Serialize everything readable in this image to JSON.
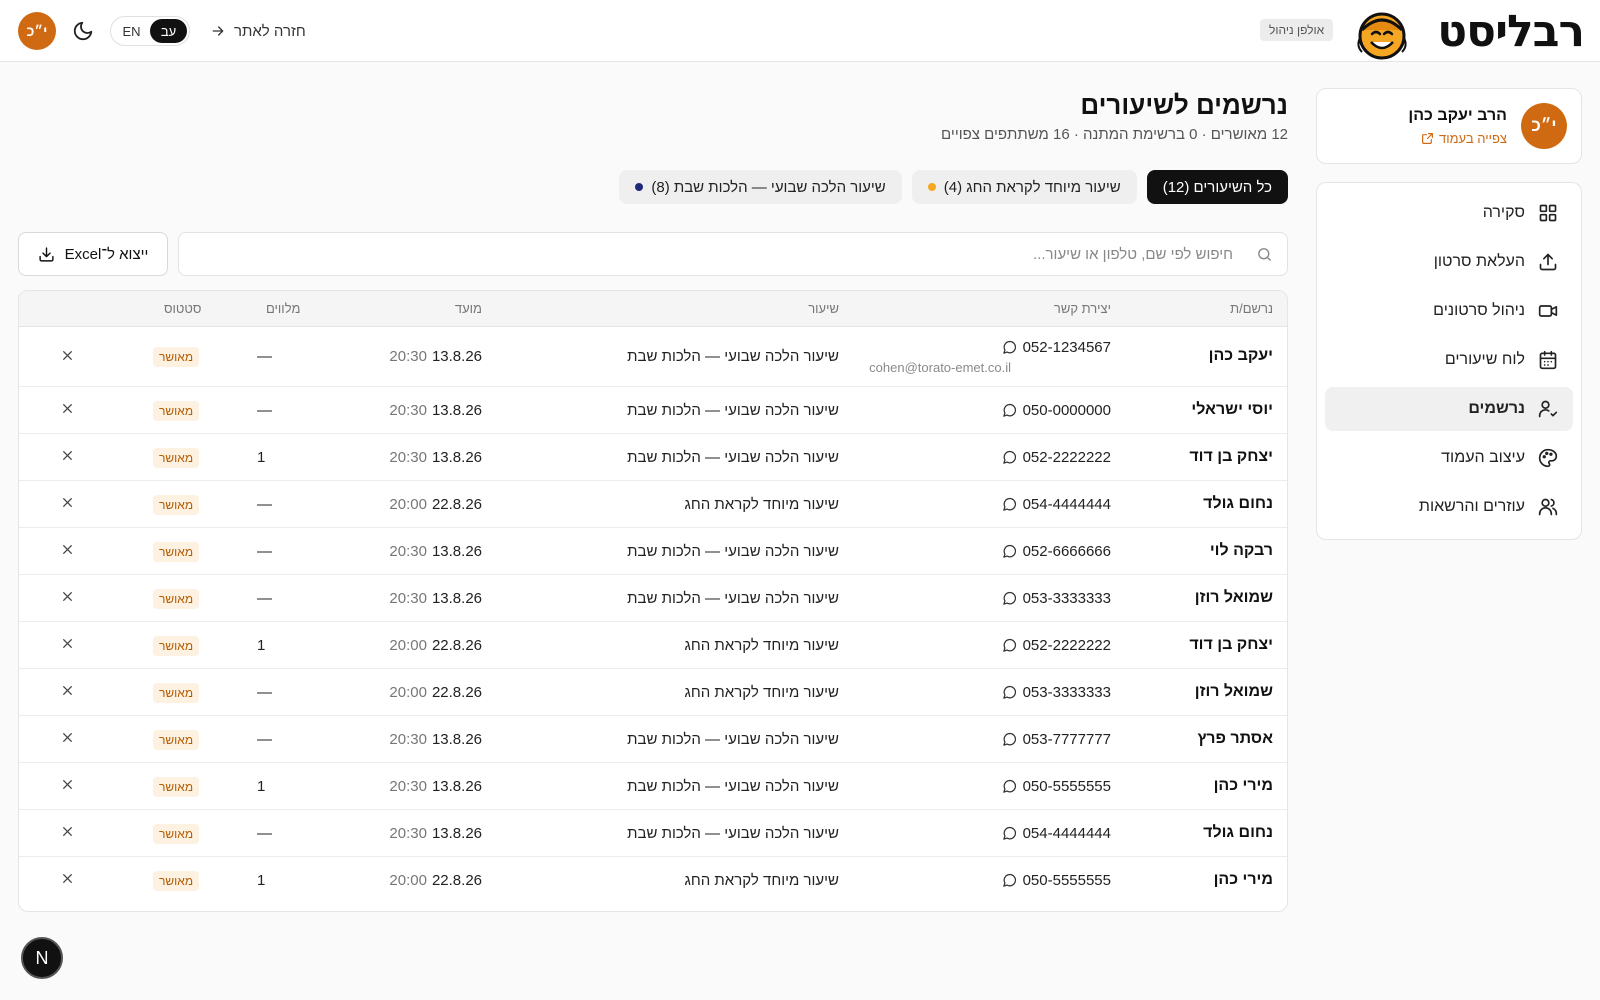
{
  "header": {
    "avatar_initials": "י״כ",
    "lang_en": "EN",
    "lang_he": "עב",
    "back_label": "חזרה לאתר",
    "studio_badge": "אולפן ניהול",
    "logo_text": "רבליסט",
    "accent_color": "#cf6a12"
  },
  "profile": {
    "initials": "י״כ",
    "name": "הרב יעקב כהן",
    "view_page_label": "צפייה בעמוד"
  },
  "nav": {
    "items": [
      {
        "label": "סקירה",
        "icon": "dashboard-icon"
      },
      {
        "label": "העלאת סרטון",
        "icon": "upload-icon"
      },
      {
        "label": "ניהול סרטונים",
        "icon": "video-icon"
      },
      {
        "label": "לוח שיעורים",
        "icon": "calendar-icon"
      },
      {
        "label": "נרשמים",
        "icon": "user-check-icon",
        "active": true
      },
      {
        "label": "עיצוב העמוד",
        "icon": "palette-icon"
      },
      {
        "label": "עוזרים והרשאות",
        "icon": "users-icon"
      }
    ]
  },
  "main": {
    "title": "נרשמים לשיעורים",
    "subtitle": "12 מאושרים · 0 ברשימת המתנה · 16 משתתפים צפויים",
    "filters": [
      {
        "label": "כל השיעורים (12)",
        "active": true,
        "dot_color": ""
      },
      {
        "label": "שיעור מיוחד לקראת החג (4)",
        "active": false,
        "dot_color": "#f5a623"
      },
      {
        "label": "שיעור הלכה שבועי — הלכות שבת (8)",
        "active": false,
        "dot_color": "#1e2a78"
      }
    ],
    "search_placeholder": "חיפוש לפי שם, טלפון או שיעור...",
    "export_label": "ייצוא ל־Excel"
  },
  "table": {
    "headers": {
      "name": "נרשם/ת",
      "contact": "יצירת קשר",
      "lesson": "שיעור",
      "time": "מועד",
      "companions": "מלווים",
      "status": "סטטוס"
    },
    "rows": [
      {
        "name": "יעקב כהן",
        "phone": "052-1234567",
        "email": "cohen@torato-emet.co.il",
        "lesson": "שיעור הלכה שבועי — הלכות שבת",
        "date": "13.8.26",
        "time": "20:30",
        "companions": "—",
        "status": "מאושר"
      },
      {
        "name": "יוסי ישראלי",
        "phone": "050-0000000",
        "email": "",
        "lesson": "שיעור הלכה שבועי — הלכות שבת",
        "date": "13.8.26",
        "time": "20:30",
        "companions": "—",
        "status": "מאושר"
      },
      {
        "name": "יצחק בן דוד",
        "phone": "052-2222222",
        "email": "",
        "lesson": "שיעור הלכה שבועי — הלכות שבת",
        "date": "13.8.26",
        "time": "20:30",
        "companions": "1",
        "status": "מאושר"
      },
      {
        "name": "נחום גולד",
        "phone": "054-4444444",
        "email": "",
        "lesson": "שיעור מיוחד לקראת החג",
        "date": "22.8.26",
        "time": "20:00",
        "companions": "—",
        "status": "מאושר"
      },
      {
        "name": "רבקה לוי",
        "phone": "052-6666666",
        "email": "",
        "lesson": "שיעור הלכה שבועי — הלכות שבת",
        "date": "13.8.26",
        "time": "20:30",
        "companions": "—",
        "status": "מאושר"
      },
      {
        "name": "שמואל רוזן",
        "phone": "053-3333333",
        "email": "",
        "lesson": "שיעור הלכה שבועי — הלכות שבת",
        "date": "13.8.26",
        "time": "20:30",
        "companions": "—",
        "status": "מאושר"
      },
      {
        "name": "יצחק בן דוד",
        "phone": "052-2222222",
        "email": "",
        "lesson": "שיעור מיוחד לקראת החג",
        "date": "22.8.26",
        "time": "20:00",
        "companions": "1",
        "status": "מאושר"
      },
      {
        "name": "שמואל רוזן",
        "phone": "053-3333333",
        "email": "",
        "lesson": "שיעור מיוחד לקראת החג",
        "date": "22.8.26",
        "time": "20:00",
        "companions": "—",
        "status": "מאושר"
      },
      {
        "name": "אסתר פרץ",
        "phone": "053-7777777",
        "email": "",
        "lesson": "שיעור הלכה שבועי — הלכות שבת",
        "date": "13.8.26",
        "time": "20:30",
        "companions": "—",
        "status": "מאושר"
      },
      {
        "name": "מירי כהן",
        "phone": "050-5555555",
        "email": "",
        "lesson": "שיעור הלכה שבועי — הלכות שבת",
        "date": "13.8.26",
        "time": "20:30",
        "companions": "1",
        "status": "מאושר"
      },
      {
        "name": "נחום גולד",
        "phone": "054-4444444",
        "email": "",
        "lesson": "שיעור הלכה שבועי — הלכות שבת",
        "date": "13.8.26",
        "time": "20:30",
        "companions": "—",
        "status": "מאושר"
      },
      {
        "name": "מירי כהן",
        "phone": "050-5555555",
        "email": "",
        "lesson": "שיעור מיוחד לקראת החג",
        "date": "22.8.26",
        "time": "20:00",
        "companions": "1",
        "status": "מאושר"
      }
    ]
  },
  "footer": {
    "badge": "N"
  }
}
